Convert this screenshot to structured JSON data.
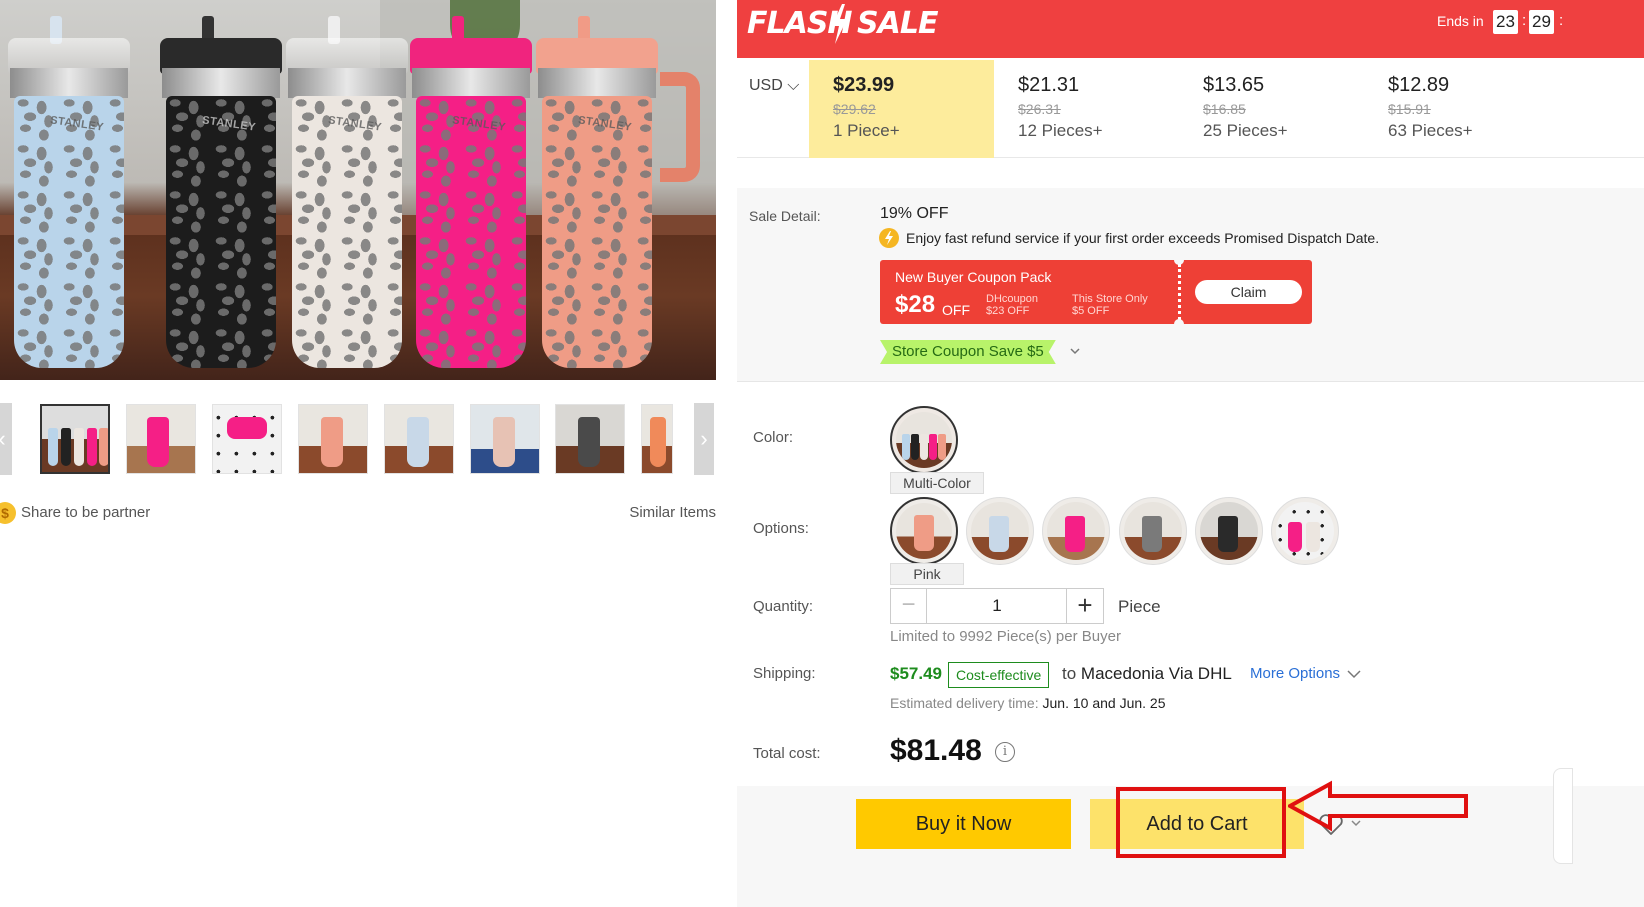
{
  "gallery": {
    "main_image_alt": "",
    "thumb_prev": "‹",
    "thumb_next": "›",
    "share_coin": "$",
    "share_label": "Share to be partner",
    "similar_label": "Similar Items",
    "cup_brand": "STANLEY"
  },
  "flash_sale": {
    "title_left": "FLASH",
    "title_right": "SALE",
    "ends_label": "Ends in",
    "hours": "23",
    "minutes": "29",
    "sep": ":"
  },
  "pricing": {
    "currency": "USD ⌵",
    "tiers": [
      {
        "price": "$23.99",
        "old": "$29.62",
        "qty": "1 Piece+"
      },
      {
        "price": "$21.31",
        "old": "$26.31",
        "qty": "12 Pieces+"
      },
      {
        "price": "$13.65",
        "old": "$16.85",
        "qty": "25 Pieces+"
      },
      {
        "price": "$12.89",
        "old": "$15.91",
        "qty": "63 Pieces+"
      }
    ]
  },
  "sale_detail": {
    "label": "Sale Detail:",
    "discount": "19% OFF",
    "refund_text": "Enjoy fast refund service if your first order exceeds Promised Dispatch Date.",
    "coupon": {
      "title": "New Buyer Coupon Pack",
      "amount": "$28",
      "off": "OFF",
      "dh_label": "DHcoupon",
      "dh_value": "$23 OFF",
      "store_label": "This Store Only",
      "store_value": "$5 OFF",
      "claim": "Claim"
    },
    "store_coupon": "Store Coupon Save $5"
  },
  "color": {
    "label": "Color:",
    "selected": "Multi-Color"
  },
  "options": {
    "label": "Options:",
    "selected": "Pink",
    "swatches": [
      "pink",
      "light-blue",
      "hot-pink",
      "gray",
      "black",
      "multi"
    ]
  },
  "quantity": {
    "label": "Quantity:",
    "minus": "−",
    "value": "1",
    "plus": "+",
    "unit": "Piece",
    "limit": "Limited to 9992 Piece(s) per Buyer"
  },
  "shipping": {
    "label": "Shipping:",
    "price": "$57.49",
    "badge": "Cost-effective",
    "to": "to",
    "destination": "Macedonia Via DHL",
    "more_options": "More Options",
    "est_label": "Estimated delivery time:",
    "date_from": "Jun. 10",
    "and": "and",
    "date_to": "Jun. 25"
  },
  "total": {
    "label": "Total cost:",
    "value": "$81.48",
    "info": "i"
  },
  "actions": {
    "buy_now": "Buy it Now",
    "add_to_cart": "Add to Cart"
  },
  "colors": {
    "flash_red": "#ef4040",
    "tier_active": "#fdec9c",
    "buy_now": "#ffc900",
    "add_cart": "#fde26a",
    "ship_green": "#1e8c1e",
    "annotation_red": "#e01010",
    "link_blue": "#2a6fd6"
  }
}
